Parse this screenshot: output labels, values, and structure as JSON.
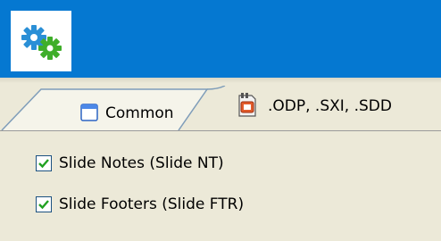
{
  "header": {
    "app_icon": "gears-icon",
    "accent_color": "#0578d1"
  },
  "tabs": [
    {
      "label": "Common",
      "icon": "window-icon",
      "active": true
    },
    {
      "label": ".ODP, .SXI, .SDD",
      "icon": "presentation-file-icon",
      "active": false
    }
  ],
  "options": [
    {
      "label": "Slide Notes (Slide NT)",
      "checked": true
    },
    {
      "label": "Slide Footers (Slide FTR)",
      "checked": true
    }
  ]
}
